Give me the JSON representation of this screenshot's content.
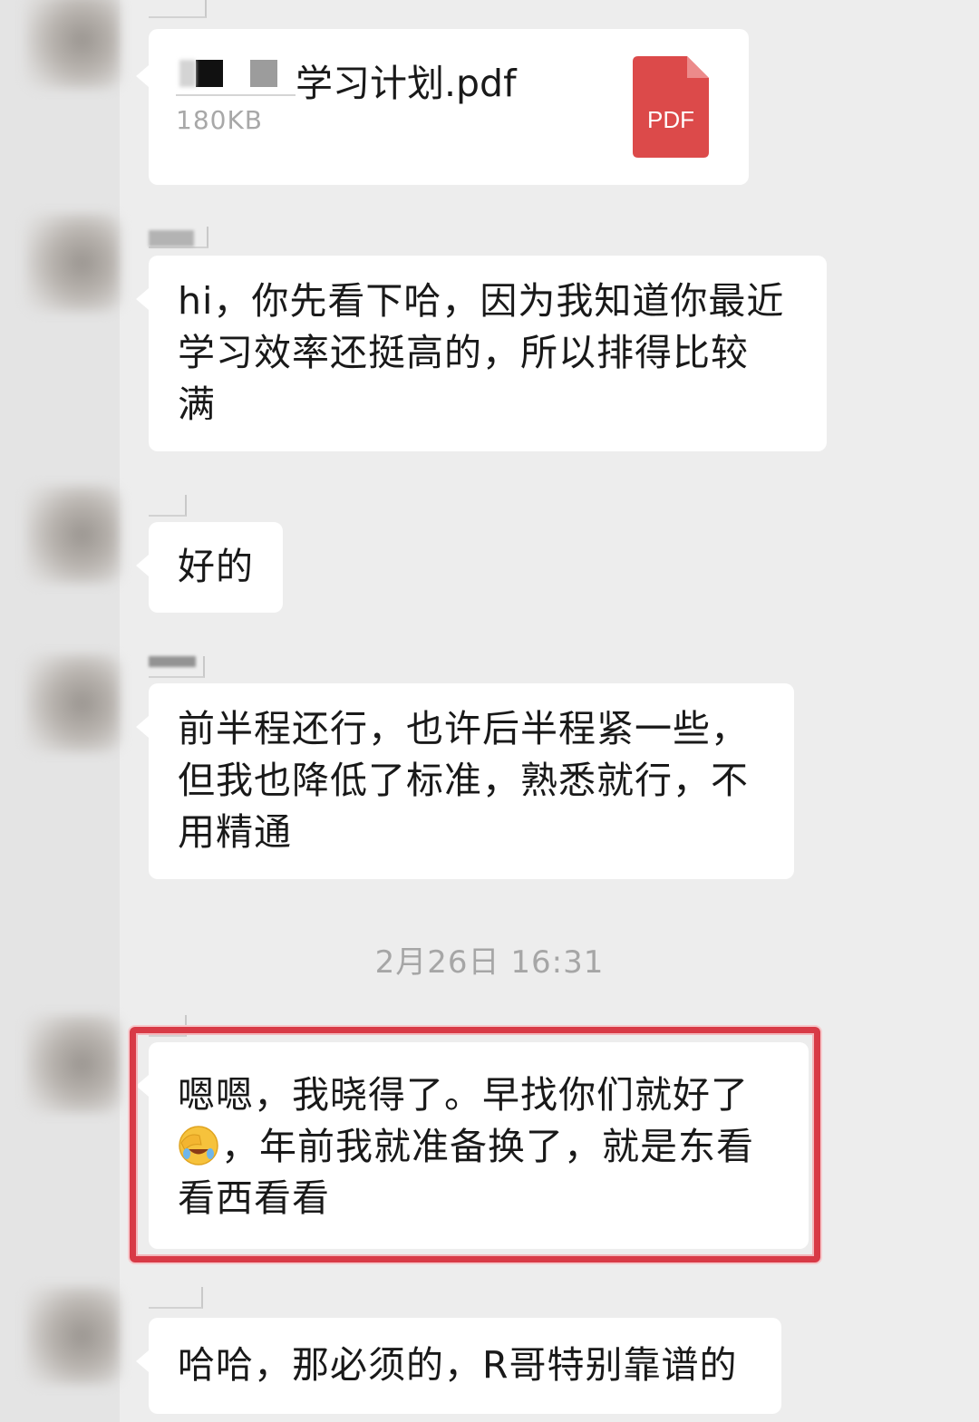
{
  "file_message": {
    "file_name": "学习计划.pdf",
    "file_size": "180KB",
    "file_type_label": "PDF",
    "file_icon": "pdf-file-icon"
  },
  "messages": [
    {
      "id": "msg1",
      "lines": [
        "hi，你先看下哈，因为我知道你最近",
        "学习效率还挺高的，所以排得比较",
        "满"
      ]
    },
    {
      "id": "msg2",
      "lines": [
        "好的"
      ]
    },
    {
      "id": "msg3",
      "lines": [
        "前半程还行，也许后半程紧一些，",
        "但我也降低了标准，熟悉就行，不",
        "用精通"
      ]
    }
  ],
  "timestamp": "2月26日 16:31",
  "highlighted_message": {
    "line1": "嗯嗯，我晓得了。早找你们就好了",
    "line2_emoji": "facepalm-laugh-emoji",
    "line2_text": "，年前我就准备换了，就是东看",
    "line3": "看西看看"
  },
  "last_message": {
    "lines": [
      "哈哈，那必须的，R哥特别靠谱的"
    ]
  },
  "colors": {
    "chat_background": "#ededed",
    "bubble": "#ffffff",
    "highlight_border": "#d83a46",
    "pdf_icon": "#dc4a4a",
    "timestamp_text": "#a6a6a6"
  }
}
